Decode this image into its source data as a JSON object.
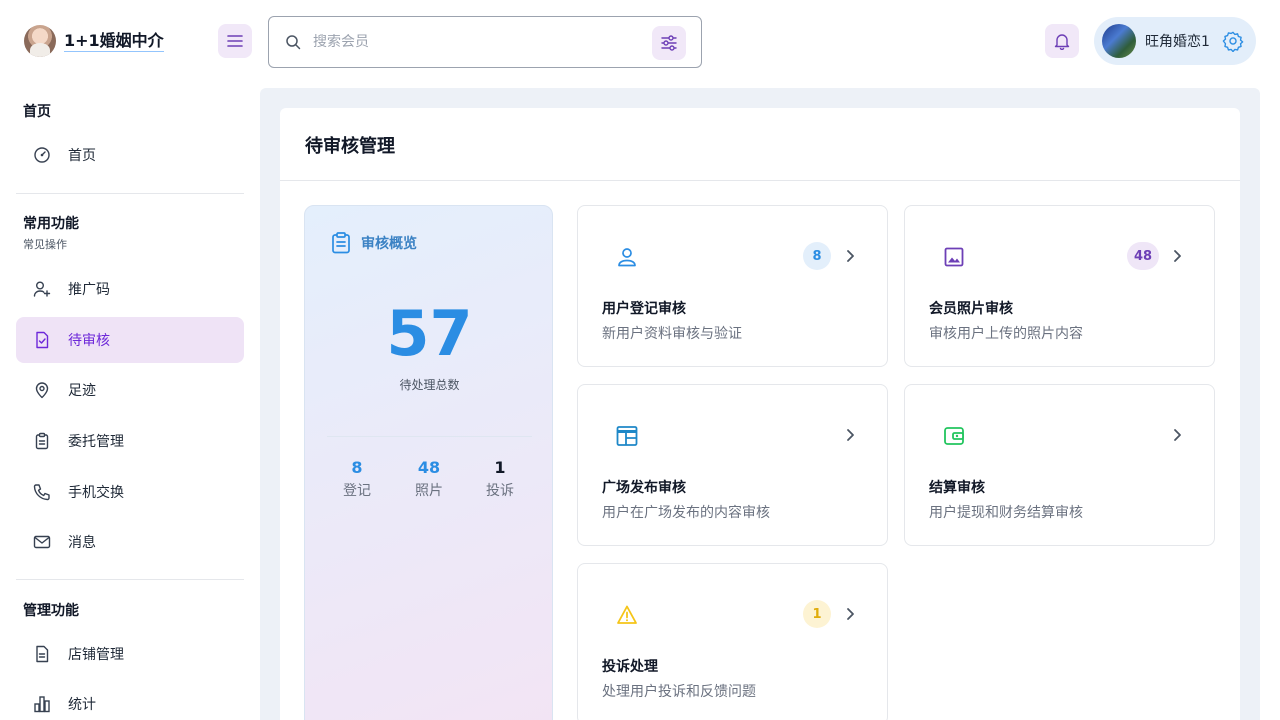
{
  "brand": {
    "name": "1+1婚姻中介"
  },
  "search": {
    "placeholder": "搜索会员"
  },
  "user": {
    "name": "旺角婚恋1"
  },
  "sidebar": {
    "sections": [
      {
        "title": "首页",
        "items": [
          {
            "label": "首页",
            "icon": "dashboard-icon"
          }
        ]
      },
      {
        "title": "常用功能",
        "subtitle": "常见操作",
        "items": [
          {
            "label": "推广码",
            "icon": "user-add-icon"
          },
          {
            "label": "待审核",
            "icon": "file-check-icon",
            "active": true
          },
          {
            "label": "足迹",
            "icon": "location-pin-icon"
          },
          {
            "label": "委托管理",
            "icon": "clipboard-icon"
          },
          {
            "label": "手机交换",
            "icon": "phone-icon"
          },
          {
            "label": "消息",
            "icon": "mail-icon"
          }
        ]
      },
      {
        "title": "管理功能",
        "items": [
          {
            "label": "店铺管理",
            "icon": "document-icon"
          },
          {
            "label": "统计",
            "icon": "bar-chart-icon"
          }
        ]
      }
    ]
  },
  "page": {
    "title": "待审核管理"
  },
  "summary": {
    "title": "审核概览",
    "total": "57",
    "total_label": "待处理总数",
    "stats": [
      {
        "value": "8",
        "label": "登记",
        "color": "#2b8de3"
      },
      {
        "value": "48",
        "label": "照片",
        "color": "#2b8de3"
      },
      {
        "value": "1",
        "label": "投诉",
        "color": "#111827"
      }
    ]
  },
  "cards": [
    {
      "title": "用户登记审核",
      "desc": "新用户资料审核与验证",
      "badge": "8",
      "icon": "user-icon",
      "color": "#2b8de3",
      "badge_bg": "#e3effb"
    },
    {
      "title": "会员照片审核",
      "desc": "审核用户上传的照片内容",
      "badge": "48",
      "icon": "image-icon",
      "color": "#6d3fb6",
      "badge_bg": "#efe6f7"
    },
    {
      "title": "广场发布审核",
      "desc": "用户在广场发布的内容审核",
      "badge": "",
      "icon": "layout-icon",
      "color": "#1e88c8",
      "badge_bg": ""
    },
    {
      "title": "结算审核",
      "desc": "用户提现和财务结算审核",
      "badge": "",
      "icon": "wallet-icon",
      "color": "#22c55e",
      "badge_bg": ""
    },
    {
      "title": "投诉处理",
      "desc": "处理用户投诉和反馈问题",
      "badge": "1",
      "icon": "warning-icon",
      "color": "#f5c518",
      "badge_bg": "#fdf3d3"
    }
  ]
}
